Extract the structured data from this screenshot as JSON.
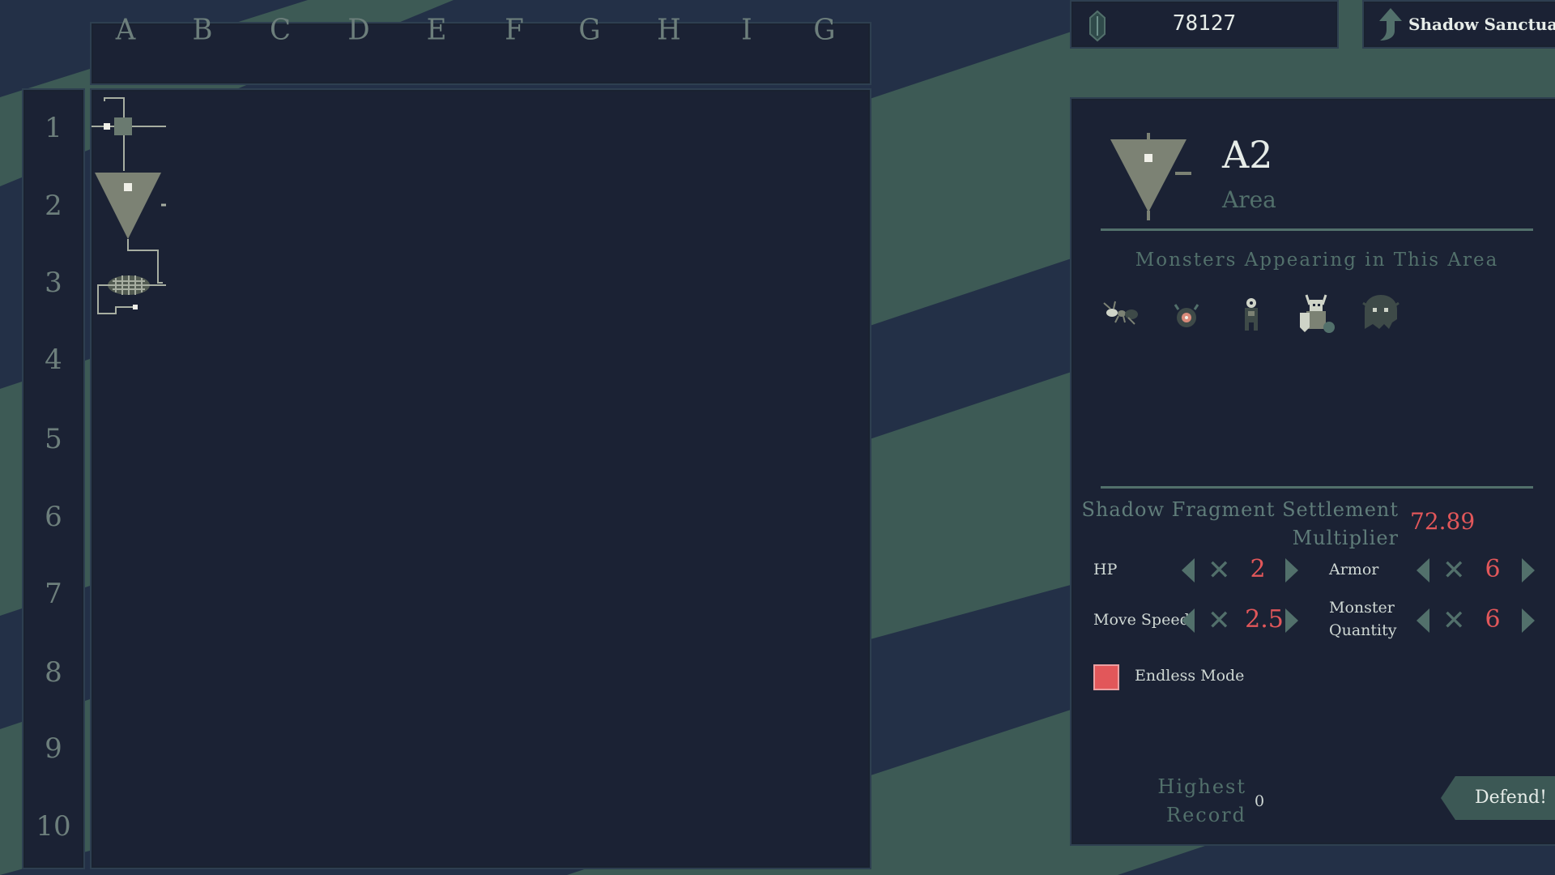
{
  "columns": [
    "A",
    "B",
    "C",
    "D",
    "E",
    "F",
    "G",
    "H",
    "I",
    "G"
  ],
  "rows": [
    "1",
    "2",
    "3",
    "4",
    "5",
    "6",
    "7",
    "8",
    "9",
    "10"
  ],
  "topbar": {
    "currency_icon": "gem-icon",
    "currency_value": "78127",
    "sanctuary_icon": "up-arrow-icon",
    "sanctuary_label": "Shadow Sanctuary"
  },
  "area": {
    "code": "A2",
    "type": "Area",
    "monsters_title": "Monsters Appearing in This Area",
    "monsters": [
      "ant-monster",
      "bomb-monster",
      "imp-monster",
      "horned-knight-monster",
      "ghost-monster"
    ]
  },
  "settlement": {
    "label_line1": "Shadow Fragment Settlement",
    "label_line2": "Multiplier",
    "value": "72.89"
  },
  "stats": {
    "hp": {
      "label": "HP",
      "value": "2"
    },
    "armor": {
      "label": "Armor",
      "value": "6"
    },
    "move_speed": {
      "label": "Move Speed",
      "value": "2.5"
    },
    "monster_quantity": {
      "label_line1": "Monster",
      "label_line2": "Quantity",
      "value": "6"
    },
    "times_symbol": "✕"
  },
  "endless_mode": {
    "label": "Endless Mode",
    "checked": true
  },
  "record": {
    "label_line1": "Highest",
    "label_line2": "Record",
    "value": "0"
  },
  "defend_label": "Defend!",
  "colors": {
    "background": "#233047",
    "stripe": "#3d5a55",
    "panel": "#1b2234",
    "accent_red": "#e2575a",
    "muted_teal": "#52706b"
  }
}
